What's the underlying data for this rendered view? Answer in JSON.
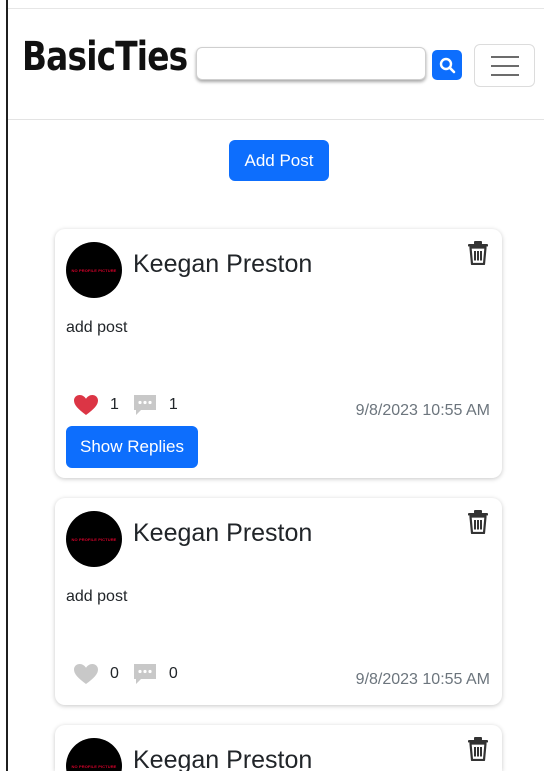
{
  "brand": {
    "name": "BasicTies"
  },
  "search": {
    "value": "",
    "placeholder": ""
  },
  "icons": {
    "search": "magnifier-icon",
    "menu": "hamburger-icon",
    "delete": "trash-icon",
    "like": "heart-icon",
    "comment": "comment-icon"
  },
  "colors": {
    "primary": "#0d6efd",
    "liked": "#dc3545",
    "not_liked": "#c8c8c8",
    "comment_icon": "#c8c8c8",
    "muted_text": "#6c757d"
  },
  "toolbar": {
    "add_post_label": "Add Post"
  },
  "posts": [
    {
      "avatar_text": "NO PROFILE PICTURE",
      "author": "Keegan Preston",
      "body": "add post",
      "likes": "1",
      "liked": true,
      "comments": "1",
      "timestamp": "9/8/2023 10:55 AM",
      "show_replies_label": "Show Replies"
    },
    {
      "avatar_text": "NO PROFILE PICTURE",
      "author": "Keegan Preston",
      "body": "add post",
      "likes": "0",
      "liked": false,
      "comments": "0",
      "timestamp": "9/8/2023 10:55 AM"
    },
    {
      "avatar_text": "NO PROFILE PICTURE",
      "author": "Keegan Preston"
    }
  ]
}
